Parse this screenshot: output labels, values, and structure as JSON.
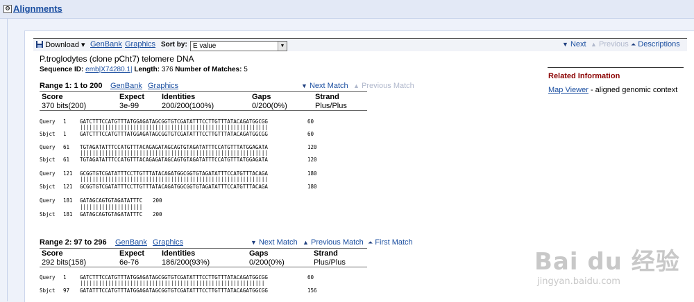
{
  "header": {
    "toggle": "⊖",
    "title": "Alignments"
  },
  "toolbar": {
    "download": "Download",
    "download_caret": "▾",
    "genbank": "GenBank",
    "graphics": "Graphics",
    "sort_label": "Sort by:",
    "sort_value": "E value",
    "next": "Next",
    "previous": "Previous",
    "descriptions": "Descriptions"
  },
  "hit": {
    "title": "P.troglodytes (clone pCht7) telomere DNA",
    "seqid_label": "Sequence ID:",
    "seqid": "emb|X74280.1|",
    "length_label": "Length:",
    "length": "376",
    "matches_label": "Number of Matches:",
    "matches": "5"
  },
  "range1": {
    "label": "Range 1: 1 to 200",
    "genbank": "GenBank",
    "graphics": "Graphics",
    "next": "Next Match",
    "previous": "Previous Match",
    "score_h": "Score",
    "expect_h": "Expect",
    "identities_h": "Identities",
    "gaps_h": "Gaps",
    "strand_h": "Strand",
    "score": "370 bits(200)",
    "expect": "3e-99",
    "identities": "200/200(100%)",
    "gaps": "0/200(0%)",
    "strand": "Plus/Plus",
    "blocks": [
      {
        "q_label": "Query",
        "q_start": "1",
        "q_seq": "GATCTTTCCATGTTTATGGAGATAGCGGTGTCGATATTTCCTTGTTTATACAGATGGCGG",
        "q_end": "60",
        "bars": "||||||||||||||||||||||||||||||||||||||||||||||||||||||||||||",
        "s_label": "Sbjct",
        "s_start": "1",
        "s_seq": "GATCTTTCCATGTTTATGGAGATAGCGGTGTCGATATTTCCTTGTTTATACAGATGGCGG",
        "s_end": "60"
      },
      {
        "q_label": "Query",
        "q_start": "61",
        "q_seq": "TGTAGATATTTCCATGTTTACAGAGATAGCAGTGTAGATATTTCCATGTTTATGGAGATA",
        "q_end": "120",
        "bars": "||||||||||||||||||||||||||||||||||||||||||||||||||||||||||||",
        "s_label": "Sbjct",
        "s_start": "61",
        "s_seq": "TGTAGATATTTCCATGTTTACAGAGATAGCAGTGTAGATATTTCCATGTTTATGGAGATA",
        "s_end": "120"
      },
      {
        "q_label": "Query",
        "q_start": "121",
        "q_seq": "GCGGTGTCGATATTTCCTTGTTTATACAGATGGCGGTGTAGATATTTCCATGTTTACAGA",
        "q_end": "180",
        "bars": "||||||||||||||||||||||||||||||||||||||||||||||||||||||||||||",
        "s_label": "Sbjct",
        "s_start": "121",
        "s_seq": "GCGGTGTCGATATTTCCTTGTTTATACAGATGGCGGTGTAGATATTTCCATGTTTACAGA",
        "s_end": "180"
      },
      {
        "q_label": "Query",
        "q_start": "181",
        "q_seq": "GATAGCAGTGTAGATATTTC",
        "q_end": "200",
        "bars": "||||||||||||||||||||",
        "s_label": "Sbjct",
        "s_start": "181",
        "s_seq": "GATAGCAGTGTAGATATTTC",
        "s_end": "200"
      }
    ]
  },
  "range2": {
    "label": "Range 2: 97 to 296",
    "genbank": "GenBank",
    "graphics": "Graphics",
    "next": "Next Match",
    "previous": "Previous Match",
    "first": "First Match",
    "score_h": "Score",
    "expect_h": "Expect",
    "identities_h": "Identities",
    "gaps_h": "Gaps",
    "strand_h": "Strand",
    "score": "292 bits(158)",
    "expect": "6e-76",
    "identities": "186/200(93%)",
    "gaps": "0/200(0%)",
    "strand": "Plus/Plus",
    "block": {
      "q_label": "Query",
      "q_start": "1",
      "q_seq": "GATCTTTCCATGTTTATGGAGATAGCGGTGTCGATATTTCCTTGTTTATACAGATGGCGG",
      "q_end": "60",
      "bars": "|||||||||||||||||||||||||||||||||||||||||||||||||||||||||||",
      "s_label": "Sbjct",
      "s_start": "97",
      "s_seq": "GATATTTCCATGTTTATGGAGATAGCGGTGTCGATATTTCCTTGTTTATACAGATGGCGG",
      "s_end": "156"
    }
  },
  "related": {
    "title": "Related Information",
    "link": "Map Viewer",
    "desc": " - aligned genomic context"
  },
  "watermark": {
    "brand": "Bai du 经验",
    "url": "jingyan.baidu.com"
  },
  "colors": {
    "link": "#1a4ea0",
    "related_title": "#8b0000",
    "disabled": "#b0b8cc"
  }
}
